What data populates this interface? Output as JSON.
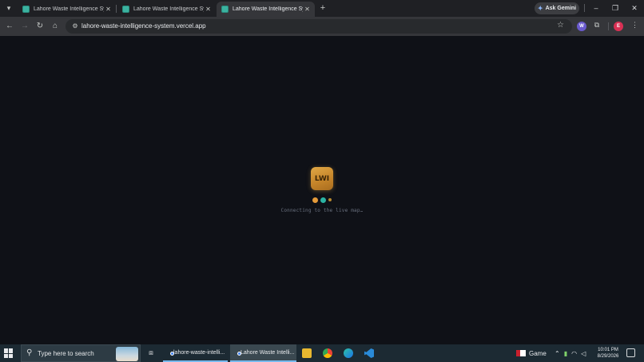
{
  "browser": {
    "tabs": [
      {
        "title": "Lahore Waste Intelligence System",
        "active": false
      },
      {
        "title": "Lahore Waste Intelligence System",
        "active": false
      },
      {
        "title": "Lahore Waste Intelligence System",
        "active": true
      }
    ],
    "new_tab_label": "+",
    "ask_gemini_label": "Ask Gemini",
    "url": "lahore-waste-intelligence-system.vercel.app",
    "profile_initial": "E",
    "extension_initial": "W"
  },
  "page": {
    "logo_text": "LWI",
    "loading_text": "Connecting to the live map…",
    "dot_colors": [
      "#e59b3a",
      "#2bb3a3",
      "#b7892f"
    ]
  },
  "taskbar": {
    "search_placeholder": "Type here to search",
    "apps": [
      {
        "label": "lahore-waste-intelli...",
        "active": false
      },
      {
        "label": "Lahore Waste Intelli...",
        "active": true
      }
    ],
    "weather_label": "Game",
    "time": "10:01 PM",
    "date": "8/29/2026"
  },
  "colors": {
    "page_background": "#0f1117",
    "logo_gold": "#d49a3a",
    "tab_active": "#35363a",
    "taskbar": "#1c2a33"
  }
}
